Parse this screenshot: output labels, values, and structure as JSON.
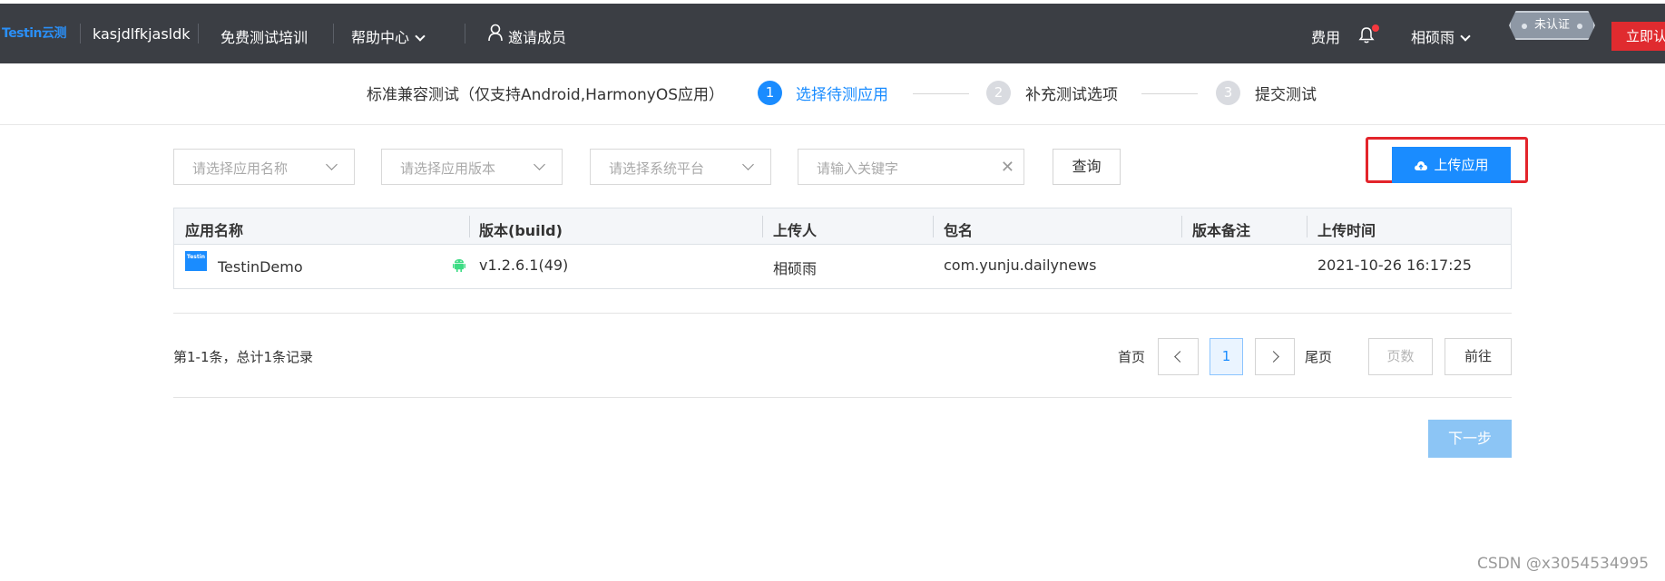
{
  "nav": {
    "logo": "Testin云测",
    "workspace": "kasjdlfkjasldk",
    "training": "免费测试培训",
    "help": "帮助中心",
    "invite": "邀请成员",
    "fees": "费用",
    "user": "相硕雨",
    "badge": "未认证",
    "certify": "立即认证"
  },
  "steps": {
    "title": "标准兼容测试（仅支持Android,HarmonyOS应用）",
    "items": [
      {
        "num": "1",
        "label": "选择待测应用"
      },
      {
        "num": "2",
        "label": "补充测试选项"
      },
      {
        "num": "3",
        "label": "提交测试"
      }
    ]
  },
  "filters": {
    "app_name_placeholder": "请选择应用名称",
    "app_version_placeholder": "请选择应用版本",
    "platform_placeholder": "请选择系统平台",
    "keyword_placeholder": "请输入关键字",
    "query": "查询",
    "upload": "上传应用"
  },
  "table": {
    "headers": [
      "应用名称",
      "版本(build)",
      "上传人",
      "包名",
      "版本备注",
      "上传时间"
    ],
    "rows": [
      {
        "logo": "Testin",
        "name": "TestinDemo",
        "platform_icon": "android-icon",
        "version": "v1.2.6.1(49)",
        "uploader": "相硕雨",
        "package": "com.yunju.dailynews",
        "note": "",
        "time": "2021-10-26 16:17:25"
      }
    ]
  },
  "pagination": {
    "summary": "第1-1条，总计1条记录",
    "first": "首页",
    "current": "1",
    "last": "尾页",
    "page_placeholder": "页数",
    "go": "前往"
  },
  "next": "下一步",
  "watermark": "CSDN @x3054534995",
  "colors": {
    "topbar": "#3b3e44",
    "primary": "#1a8cff",
    "danger": "#e02b2f",
    "highlight": "#e3242b"
  }
}
